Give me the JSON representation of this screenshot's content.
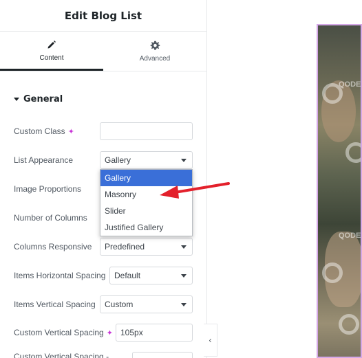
{
  "panel": {
    "title": "Edit Blog List",
    "tabs": [
      {
        "label": "Content",
        "icon": "pencil-icon",
        "active": true
      },
      {
        "label": "Advanced",
        "icon": "gear-icon",
        "active": false
      }
    ]
  },
  "section": {
    "title": "General"
  },
  "fields": {
    "custom_class": {
      "label": "Custom Class",
      "value": ""
    },
    "list_appearance": {
      "label": "List Appearance",
      "value": "Gallery"
    },
    "image_proportions": {
      "label": "Image Proportions"
    },
    "number_of_columns": {
      "label": "Number of Columns"
    },
    "columns_responsive": {
      "label": "Columns Responsive",
      "value": "Predefined"
    },
    "items_horizontal_spacing": {
      "label": "Items Horizontal Spacing",
      "value": "Default"
    },
    "items_vertical_spacing": {
      "label": "Items Vertical Spacing",
      "value": "Custom"
    },
    "custom_vertical_spacing": {
      "label": "Custom Vertical Spacing",
      "value": "105px"
    },
    "custom_vertical_spacing_2": {
      "label": "Custom Vertical Spacing -"
    }
  },
  "dropdown": {
    "options": [
      "Gallery",
      "Masonry",
      "Slider",
      "Justified Gallery"
    ],
    "selected": "Gallery"
  },
  "preview": {
    "watermark": "QODE"
  },
  "colors": {
    "selected_option": "#3a6fd8",
    "annotation_arrow": "#e3202b",
    "preview_border": "#d5a8e8"
  }
}
